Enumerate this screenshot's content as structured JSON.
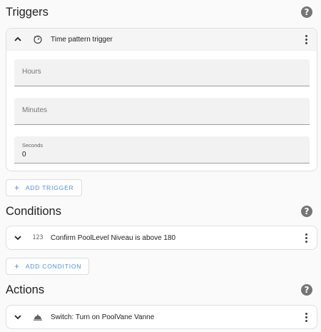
{
  "triggers": {
    "title": "Triggers",
    "help_icon": "help-circle-icon",
    "card": {
      "title": "Time pattern trigger",
      "icon": "timer-outline-icon",
      "fields": {
        "hours": {
          "placeholder": "Hours",
          "value": ""
        },
        "minutes": {
          "placeholder": "Minutes",
          "value": ""
        },
        "seconds": {
          "label": "Seconds",
          "value": "0"
        }
      }
    },
    "add_label": "ADD TRIGGER"
  },
  "conditions": {
    "title": "Conditions",
    "help_icon": "help-circle-icon",
    "card": {
      "title": "Confirm PoolLevel Niveau is above 180",
      "icon_text": "123"
    },
    "add_label": "ADD CONDITION"
  },
  "actions": {
    "title": "Actions",
    "help_icon": "help-circle-icon",
    "card": {
      "title": "Switch: Turn on PoolVane Vanne",
      "icon": "room-service-icon"
    }
  },
  "colors": {
    "accent": "#4a90d9",
    "background": "#fafafa",
    "card": "#ffffff"
  }
}
